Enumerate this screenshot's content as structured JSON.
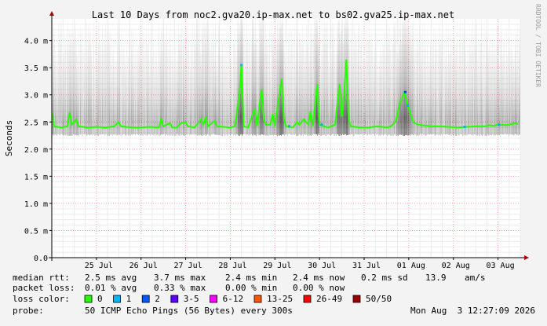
{
  "chart_data": {
    "type": "line",
    "title": "Last 10 Days from noc2.gva20.ip-max.net to bs02.gva25.ip-max.net",
    "ylabel": "Seconds",
    "watermark": "RRDTOOL / TOBI OETIKER",
    "ylim": [
      0,
      4.4
    ],
    "y_ticks": [
      {
        "value": 0.0,
        "label": "0.0"
      },
      {
        "value": 0.5,
        "label": "0.5 m"
      },
      {
        "value": 1.0,
        "label": "1.0 m"
      },
      {
        "value": 1.5,
        "label": "1.5 m"
      },
      {
        "value": 2.0,
        "label": "2.0 m"
      },
      {
        "value": 2.5,
        "label": "2.5 m"
      },
      {
        "value": 3.0,
        "label": "3.0 m"
      },
      {
        "value": 3.5,
        "label": "3.5 m"
      },
      {
        "value": 4.0,
        "label": "4.0 m"
      }
    ],
    "y_unit": "ms",
    "xlim": [
      0,
      10.5
    ],
    "x_unit": "days since start of plot (start ≈ 24 Jul 00:00)",
    "x_ticks": [
      {
        "value": 1,
        "label": "25 Jul"
      },
      {
        "value": 2,
        "label": "26 Jul"
      },
      {
        "value": 3,
        "label": "27 Jul"
      },
      {
        "value": 4,
        "label": "28 Jul"
      },
      {
        "value": 5,
        "label": "29 Jul"
      },
      {
        "value": 6,
        "label": "30 Jul"
      },
      {
        "value": 7,
        "label": "31 Jul"
      },
      {
        "value": 8,
        "label": "01 Aug"
      },
      {
        "value": 9,
        "label": "02 Aug"
      },
      {
        "value": 10,
        "label": "03 Aug"
      }
    ],
    "grid": true,
    "median_series": {
      "name": "median rtt",
      "points": [
        [
          0.0,
          2.7
        ],
        [
          0.05,
          2.42
        ],
        [
          0.2,
          2.4
        ],
        [
          0.35,
          2.42
        ],
        [
          0.4,
          2.68
        ],
        [
          0.45,
          2.45
        ],
        [
          0.55,
          2.55
        ],
        [
          0.6,
          2.42
        ],
        [
          0.8,
          2.4
        ],
        [
          1.0,
          2.41
        ],
        [
          1.2,
          2.4
        ],
        [
          1.4,
          2.42
        ],
        [
          1.5,
          2.5
        ],
        [
          1.55,
          2.42
        ],
        [
          1.8,
          2.4
        ],
        [
          2.0,
          2.4
        ],
        [
          2.2,
          2.41
        ],
        [
          2.4,
          2.4
        ],
        [
          2.45,
          2.55
        ],
        [
          2.5,
          2.42
        ],
        [
          2.65,
          2.48
        ],
        [
          2.7,
          2.4
        ],
        [
          2.8,
          2.4
        ],
        [
          2.9,
          2.48
        ],
        [
          3.0,
          2.5
        ],
        [
          3.05,
          2.42
        ],
        [
          3.2,
          2.4
        ],
        [
          3.35,
          2.55
        ],
        [
          3.4,
          2.45
        ],
        [
          3.45,
          2.6
        ],
        [
          3.5,
          2.42
        ],
        [
          3.65,
          2.52
        ],
        [
          3.7,
          2.42
        ],
        [
          4.0,
          2.4
        ],
        [
          4.1,
          2.42
        ],
        [
          4.2,
          2.95
        ],
        [
          4.25,
          3.55
        ],
        [
          4.3,
          2.42
        ],
        [
          4.4,
          2.4
        ],
        [
          4.55,
          2.75
        ],
        [
          4.6,
          2.42
        ],
        [
          4.7,
          3.1
        ],
        [
          4.75,
          2.55
        ],
        [
          4.8,
          2.45
        ],
        [
          4.9,
          2.45
        ],
        [
          4.95,
          2.65
        ],
        [
          5.0,
          2.42
        ],
        [
          5.15,
          3.3
        ],
        [
          5.2,
          2.55
        ],
        [
          5.25,
          2.42
        ],
        [
          5.4,
          2.4
        ],
        [
          5.5,
          2.5
        ],
        [
          5.55,
          2.45
        ],
        [
          5.65,
          2.55
        ],
        [
          5.7,
          2.5
        ],
        [
          5.75,
          2.45
        ],
        [
          5.8,
          2.7
        ],
        [
          5.85,
          2.42
        ],
        [
          5.95,
          3.2
        ],
        [
          6.0,
          2.45
        ],
        [
          6.1,
          2.42
        ],
        [
          6.2,
          2.4
        ],
        [
          6.35,
          2.45
        ],
        [
          6.45,
          3.2
        ],
        [
          6.5,
          2.6
        ],
        [
          6.55,
          3.0
        ],
        [
          6.6,
          3.65
        ],
        [
          6.65,
          2.55
        ],
        [
          6.7,
          2.42
        ],
        [
          6.9,
          2.4
        ],
        [
          7.1,
          2.4
        ],
        [
          7.3,
          2.42
        ],
        [
          7.5,
          2.4
        ],
        [
          7.6,
          2.42
        ],
        [
          7.7,
          2.5
        ],
        [
          7.75,
          2.65
        ],
        [
          7.8,
          2.85
        ],
        [
          7.85,
          2.95
        ],
        [
          7.9,
          3.05
        ],
        [
          7.95,
          2.9
        ],
        [
          8.0,
          2.75
        ],
        [
          8.05,
          2.62
        ],
        [
          8.1,
          2.5
        ],
        [
          8.2,
          2.45
        ],
        [
          8.3,
          2.44
        ],
        [
          8.5,
          2.42
        ],
        [
          8.7,
          2.42
        ],
        [
          8.9,
          2.41
        ],
        [
          9.1,
          2.4
        ],
        [
          9.3,
          2.41
        ],
        [
          9.5,
          2.42
        ],
        [
          9.7,
          2.42
        ],
        [
          9.8,
          2.44
        ],
        [
          9.9,
          2.43
        ],
        [
          10.0,
          2.45
        ],
        [
          10.2,
          2.44
        ],
        [
          10.3,
          2.46
        ],
        [
          10.4,
          2.48
        ],
        [
          10.45,
          2.46
        ]
      ]
    },
    "loss_markers": [
      {
        "x": 4.25,
        "y": 3.55,
        "color": "#00b4e6",
        "label": "1"
      },
      {
        "x": 5.32,
        "y": 2.42,
        "color": "#00b4e6",
        "label": "1"
      },
      {
        "x": 6.05,
        "y": 2.45,
        "color": "#00b4e6",
        "label": "1"
      },
      {
        "x": 7.92,
        "y": 3.05,
        "color": "#0040ff",
        "label": "2"
      },
      {
        "x": 7.98,
        "y": 2.8,
        "color": "#00b4e6",
        "label": "1"
      },
      {
        "x": 9.25,
        "y": 2.41,
        "color": "#00b4e6",
        "label": "1"
      },
      {
        "x": 10.02,
        "y": 2.45,
        "color": "#00b4e6",
        "label": "1"
      }
    ],
    "legend": {
      "label": "loss color:",
      "items": [
        {
          "label": "0",
          "color": "#26ff00"
        },
        {
          "label": "1",
          "color": "#00b8ff"
        },
        {
          "label": "2",
          "color": "#0059ff"
        },
        {
          "label": "3-5",
          "color": "#5e00ff"
        },
        {
          "label": "6-12",
          "color": "#ff00ff"
        },
        {
          "label": "13-25",
          "color": "#ff5500"
        },
        {
          "label": "26-49",
          "color": "#ff0000"
        },
        {
          "label": "50/50",
          "color": "#a10000"
        }
      ]
    },
    "stats": {
      "median_rtt": {
        "label": "median rtt:",
        "avg": "2.5 ms avg",
        "max": "3.7 ms max",
        "min": "2.4 ms min",
        "now": "2.4 ms now",
        "sd": "0.2 ms sd",
        "ams": "13.9",
        "ams_unit": "am/s"
      },
      "packet_loss": {
        "label": "packet loss:",
        "avg": "0.01 % avg",
        "max": "0.33 % max",
        "min": "0.00 % min",
        "now": "0.00 % now"
      },
      "probe": {
        "label": "probe:",
        "text": "50 ICMP Echo Pings (56 Bytes) every 300s",
        "timestamp": "Mon Aug  3 12:27:09 2026"
      }
    }
  }
}
